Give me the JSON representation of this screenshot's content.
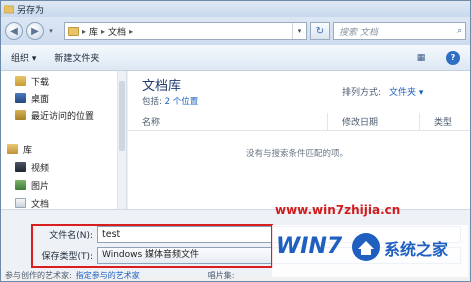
{
  "window": {
    "title": "另存为"
  },
  "address": {
    "crumbs": [
      "库",
      "文档"
    ],
    "search_placeholder": "搜索 文档"
  },
  "toolbar": {
    "organize_label": "组织 ▾",
    "new_folder_label": "新建文件夹"
  },
  "navpane": {
    "items": [
      {
        "label": "下载",
        "icon": "download-folder-icon"
      },
      {
        "label": "桌面",
        "icon": "desktop-icon"
      },
      {
        "label": "最近访问的位置",
        "icon": "recent-places-icon"
      },
      {
        "label": "库",
        "icon": "library-icon"
      },
      {
        "label": "视频",
        "icon": "video-library-icon"
      },
      {
        "label": "图片",
        "icon": "pictures-library-icon"
      },
      {
        "label": "文档",
        "icon": "documents-library-icon"
      }
    ]
  },
  "content": {
    "library_title": "文档库",
    "includes_label": "包括:",
    "locations_link": "2 个位置",
    "arrange_label": "排列方式:",
    "arrange_value": "文件夹 ▾",
    "columns": [
      "名称",
      "修改日期",
      "类型"
    ],
    "empty_message": "没有与搜索条件匹配的项。"
  },
  "form": {
    "filename_label": "文件名(N):",
    "filename_value": "test",
    "filetype_label": "保存类型(T):",
    "filetype_value": "Windows 媒体音频文件",
    "artists_label": "参与创作的艺术家:",
    "artists_link": "指定参与的艺术家",
    "album_label": "唱片集:"
  },
  "watermark": {
    "url": "www.win7zhijia.cn",
    "brand_text": "系统之家",
    "logo_letters": "WIN7"
  },
  "colors": {
    "highlight": "#d81e1e",
    "link": "#1b5fbf",
    "watermark_blue": "#1e5fbf"
  }
}
